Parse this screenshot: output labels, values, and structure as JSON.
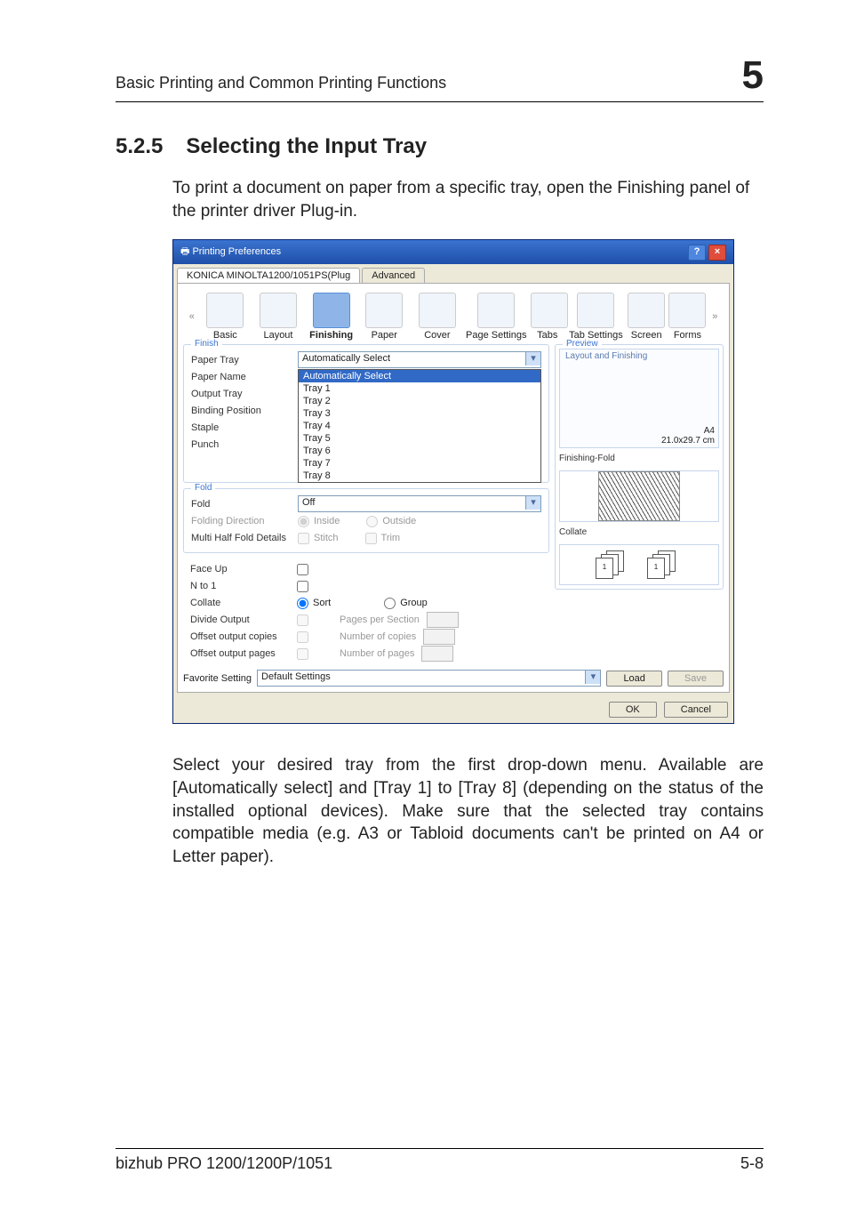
{
  "chapterNum": "5",
  "header": "Basic Printing and Common Printing Functions",
  "section": {
    "num": "5.2.5",
    "title": "Selecting the Input Tray"
  },
  "p1": "To print a document on paper from a specific tray, open the Finishing panel of the printer driver Plug-in.",
  "p2": "Select your desired tray from the first drop-down menu. Available are [Automatically select] and [Tray 1] to [Tray 8] (depending on the status of the installed optional devices). Make sure that the selected tray contains compatible media (e.g. A3 or Tabloid documents can't be printed on A4 or Letter paper).",
  "footer": {
    "left": "bizhub PRO 1200/1200P/1051",
    "right": "5-8"
  },
  "dlg": {
    "title": "Printing Preferences",
    "tabs": [
      "KONICA MINOLTA1200/1051PS(Plug",
      "Advanced"
    ],
    "icons": [
      "Basic",
      "Layout",
      "Finishing",
      "Paper",
      "Cover",
      "Page Settings",
      "Tabs",
      "Tab Settings",
      "Screen",
      "Forms"
    ],
    "finish": {
      "legend": "Finish",
      "paperTrayLab": "Paper Tray",
      "paperTrayVal": "Automatically Select",
      "menu": [
        "Automatically Select",
        "Tray 1",
        "Tray 2",
        "Tray 3",
        "Tray 4",
        "Tray 5",
        "Tray 6",
        "Tray 7",
        "Tray 8"
      ],
      "paperNameLab": "Paper Name",
      "outputTrayLab": "Output Tray",
      "bindingLab": "Binding Position",
      "stapleLab": "Staple",
      "punchLab": "Punch"
    },
    "fold": {
      "legend": "Fold",
      "foldLab": "Fold",
      "foldVal": "Off",
      "dirLab": "Folding Direction",
      "inside": "Inside",
      "outside": "Outside",
      "multiLab": "Multi Half Fold Details",
      "stitch": "Stitch",
      "trim": "Trim"
    },
    "lower": {
      "faceUp": "Face Up",
      "nto1": "N to 1",
      "collate": "Collate",
      "sort": "Sort",
      "group": "Group",
      "divide": "Divide Output",
      "pagesPer": "Pages per Section",
      "offsetCopies": "Offset output copies",
      "numCopies": "Number of copies",
      "offsetPages": "Offset output pages",
      "numPages": "Number of pages"
    },
    "preview": {
      "legend": "Preview",
      "layout": "Layout and Finishing",
      "size": "A4",
      "dim": "21.0x29.7 cm",
      "finFold": "Finishing-Fold",
      "collate": "Collate"
    },
    "fav": {
      "lab": "Favorite Setting",
      "val": "Default Settings",
      "load": "Load",
      "save": "Save"
    },
    "ok": "OK",
    "cancel": "Cancel"
  }
}
